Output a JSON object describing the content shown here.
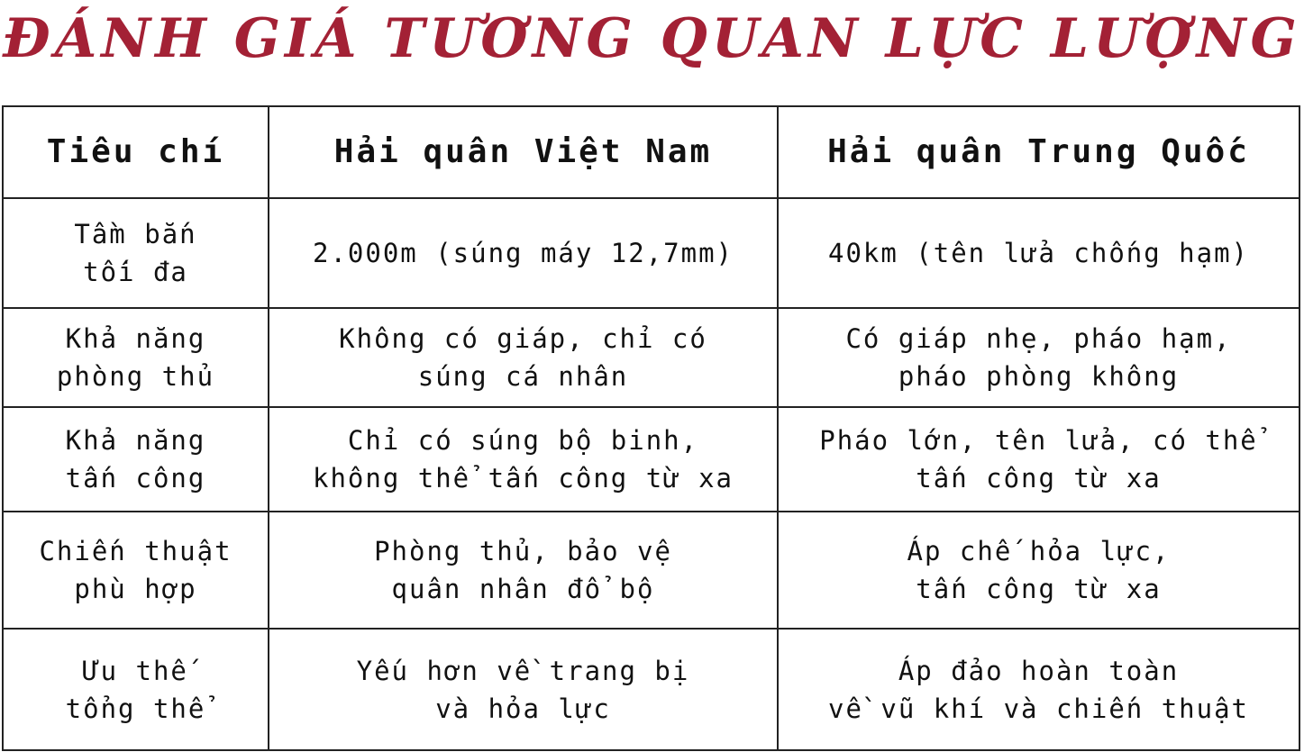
{
  "title": "ĐÁNH GIÁ TƯƠNG QUAN LỰC LƯỢNG",
  "colors": {
    "title": "#a32135",
    "text": "#111111",
    "border": "#222222"
  },
  "table": {
    "headers": [
      "Tiêu chí",
      "Hải quân Việt Nam",
      "Hải quân Trung Quốc"
    ],
    "rows": [
      {
        "criterion": "Tầm bắn\ntối đa",
        "vietnam": "2.000m (súng máy 12,7mm)",
        "china": "40km (tên lửa chống hạm)"
      },
      {
        "criterion": "Khả năng\nphòng thủ",
        "vietnam": "Không có giáp, chỉ có\nsúng cá nhân",
        "china": "Có giáp nhẹ, pháo hạm,\npháo phòng không"
      },
      {
        "criterion": "Khả năng\ntấn công",
        "vietnam": "Chỉ có súng bộ binh,\nkhông thể tấn công từ xa",
        "china": "Pháo lớn, tên lửa, có thể\ntấn công từ xa"
      },
      {
        "criterion": "Chiến thuật\nphù hợp",
        "vietnam": "Phòng thủ, bảo vệ\nquân nhân đổ bộ",
        "china": "Áp chế hỏa lực,\ntấn công từ xa"
      },
      {
        "criterion": "Ưu thế\ntổng thể",
        "vietnam": "Yếu hơn về trang bị\nvà hỏa lực",
        "china": "Áp đảo hoàn toàn\nvề vũ khí và chiến thuật"
      }
    ]
  }
}
